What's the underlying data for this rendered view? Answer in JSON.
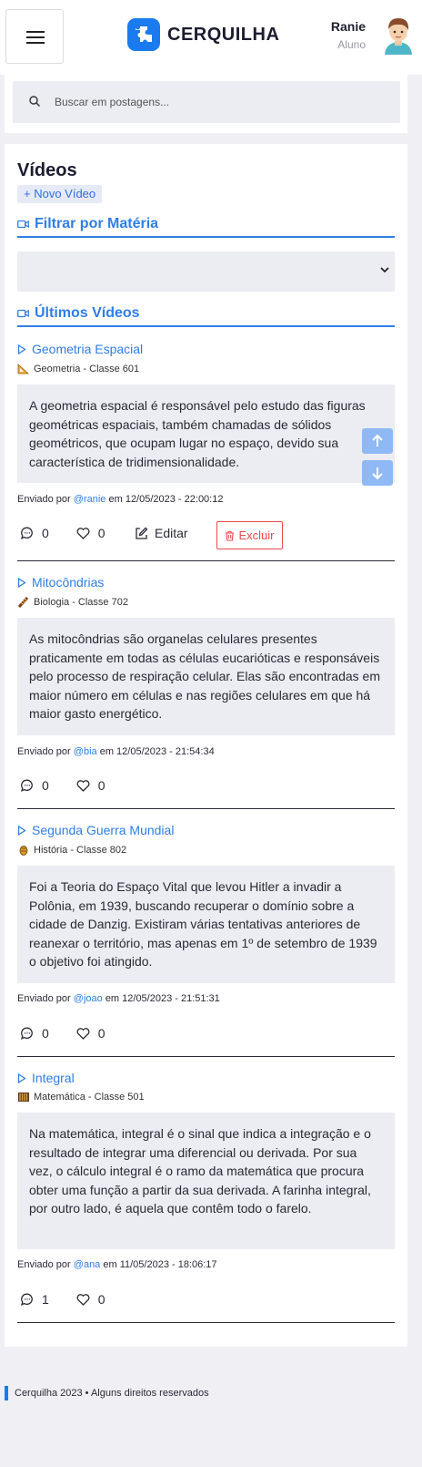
{
  "header": {
    "menu_icon": "hamburger-menu-icon",
    "brand": "CERQUILHA",
    "brand_color": "#1a7bf0",
    "user_name": "Ranie",
    "user_role": "Aluno"
  },
  "search": {
    "placeholder": "Buscar em postagens..."
  },
  "main": {
    "title": "Vídeos",
    "new_button": "+ Novo Vídeo",
    "filter_title": "Filtrar por Matéria",
    "filter_selected": "",
    "latest_title": "Últimos Vídeos",
    "accent_color": "#2f7ee6"
  },
  "posts": [
    {
      "title": "Geometria Espacial",
      "subject_icon": "triangle-ruler-icon",
      "meta": "Geometria - Classe 601",
      "body": "A geometria espacial é responsável pelo estudo das figuras geométricas espaciais, também chamadas de sólidos geométricos, que ocupam lugar no espaço, devido sua característica de tridimensionalidade.",
      "sent_prefix": "Enviado por",
      "author": "@ranie",
      "sent_suffix": "em 12/05/2023 - 22:00:12",
      "comments": "0",
      "likes": "0",
      "edit_label": "Editar",
      "delete_label": "Excluir"
    },
    {
      "title": "Mitocôndrias",
      "subject_icon": "dna-icon",
      "meta": "Biologia - Classe 702",
      "body": "As mitocôndrias são organelas celulares presentes praticamente em todas as células eucarióticas e responsáveis pelo processo de respiração celular. Elas são encontradas em maior número em células e nas regiões celulares em que há maior gasto energético.",
      "sent_prefix": "Enviado por",
      "author": "@bia",
      "sent_suffix": "em 12/05/2023 - 21:54:34",
      "comments": "0",
      "likes": "0"
    },
    {
      "title": "Segunda Guerra Mundial",
      "subject_icon": "amphora-icon",
      "meta": "História - Classe 802",
      "body": "Foi a Teoria do Espaço Vital que levou Hitler a invadir a Polônia, em 1939, buscando recuperar o domínio sobre a cidade de Danzig. Existiram várias tentativas anteriores de reanexar o território, mas apenas em 1º de setembro de 1939 o objetivo foi atingido.",
      "sent_prefix": "Enviado por",
      "author": "@joao",
      "sent_suffix": "em 12/05/2023 - 21:51:31",
      "comments": "0",
      "likes": "0"
    },
    {
      "title": "Integral",
      "subject_icon": "abacus-icon",
      "meta": "Matemática - Classe 501",
      "body": "Na matemática, integral é o sinal que indica a integração e o resultado de integrar uma diferencial ou derivada. Por sua vez, o cálculo integral é o ramo da matemática que procura obter uma função a partir da sua derivada. A farinha integral, por outro lado, é aquela que contêm todo o farelo.",
      "sent_prefix": "Enviado por",
      "author": "@ana",
      "sent_suffix": "em 11/05/2023 - 18:06:17",
      "comments": "1",
      "likes": "0"
    }
  ],
  "footer": {
    "text": "Cerquilha 2023 • Alguns direitos reservados"
  }
}
